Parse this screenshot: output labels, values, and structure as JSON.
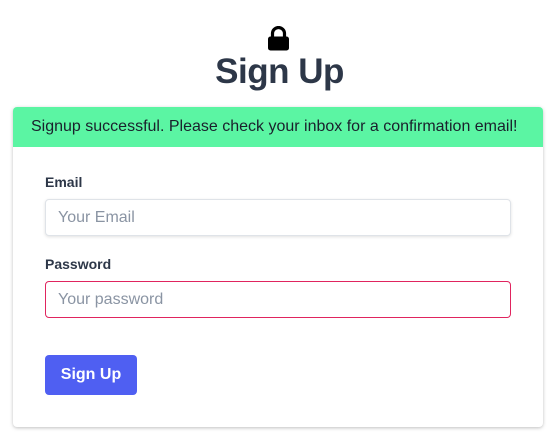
{
  "header": {
    "icon": "lock-icon",
    "title": "Sign Up"
  },
  "alert": {
    "message": "Signup successful. Please check your inbox for a confirmation email!",
    "color": "#5bf5a3"
  },
  "form": {
    "email": {
      "label": "Email",
      "value": "",
      "placeholder": "Your Email"
    },
    "password": {
      "label": "Password",
      "value": "",
      "placeholder": "Your password",
      "border_color": "#e0245e"
    },
    "submit_label": "Sign Up",
    "submit_color": "#4f5ff2"
  }
}
